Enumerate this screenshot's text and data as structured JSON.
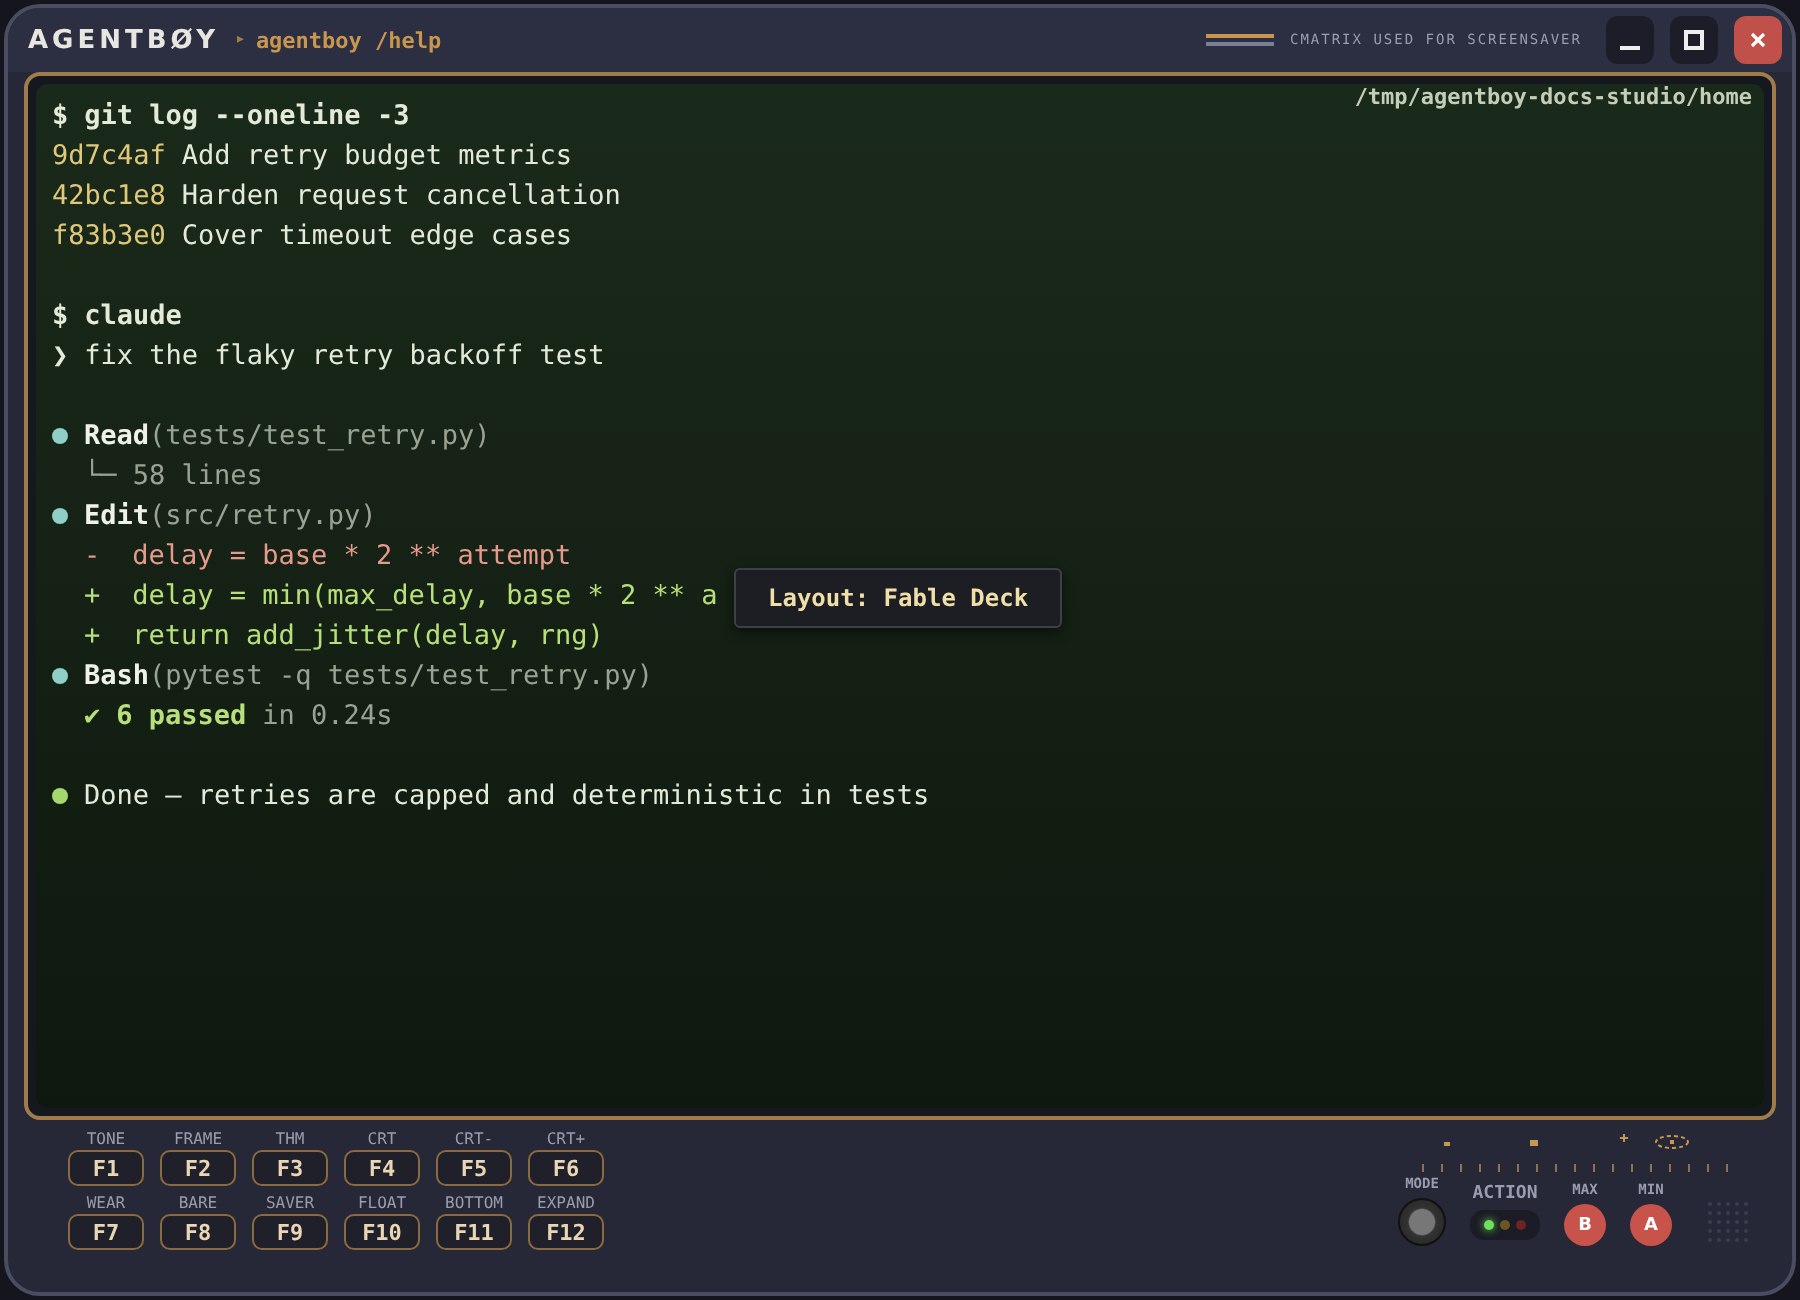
{
  "titlebar": {
    "logo": "AGENTBØY",
    "separator": "▸",
    "command": "agentboy /help",
    "notice": "CMATRIX USED FOR SCREENSAVER"
  },
  "terminal": {
    "path": "/tmp/agentboy-docs-studio/home",
    "lines": [
      {
        "kind": "command",
        "prompt": "$",
        "text": "git log --oneline -3"
      },
      {
        "kind": "commit",
        "hash": "9d7c4af",
        "text": "Add retry budget metrics"
      },
      {
        "kind": "commit",
        "hash": "42bc1e8",
        "text": "Harden request cancellation"
      },
      {
        "kind": "commit",
        "hash": "f83b3e0",
        "text": "Cover timeout edge cases"
      },
      {
        "kind": "blank"
      },
      {
        "kind": "command",
        "prompt": "$",
        "text": "claude"
      },
      {
        "kind": "input",
        "prompt": "❯",
        "text": "fix the flaky retry backoff test"
      },
      {
        "kind": "blank"
      },
      {
        "kind": "tool",
        "color": "#8ecfc6",
        "name": "Read",
        "args": "(tests/test_retry.py)"
      },
      {
        "kind": "output",
        "text": "└─ 58 lines"
      },
      {
        "kind": "tool",
        "color": "#8ecfc6",
        "name": "Edit",
        "args": "(src/retry.py)"
      },
      {
        "kind": "removed",
        "sign": "-",
        "text": "delay = base * 2 ** attempt"
      },
      {
        "kind": "added",
        "sign": "+",
        "text": "delay = min(max_delay, base * 2 ** a"
      },
      {
        "kind": "added",
        "sign": "+",
        "text": "return add_jitter(delay, rng)"
      },
      {
        "kind": "tool",
        "color": "#8ecfc6",
        "name": "Bash",
        "args": "(pytest -q tests/test_retry.py)"
      },
      {
        "kind": "pass",
        "mark": "✔",
        "text": "6 passed",
        "rest": "in 0.24s"
      },
      {
        "kind": "blank"
      },
      {
        "kind": "done",
        "color": "#a6d66e",
        "text": "Done — retries are capped and deterministic in tests"
      }
    ],
    "tooltip": "Layout: Fable Deck"
  },
  "function_keys": [
    [
      {
        "label": "TONE",
        "key": "F1"
      },
      {
        "label": "FRAME",
        "key": "F2"
      },
      {
        "label": "THM",
        "key": "F3"
      },
      {
        "label": "CRT",
        "key": "F4"
      },
      {
        "label": "CRT-",
        "key": "F5"
      },
      {
        "label": "CRT+",
        "key": "F6"
      }
    ],
    [
      {
        "label": "WEAR",
        "key": "F7"
      },
      {
        "label": "BARE",
        "key": "F8"
      },
      {
        "label": "SAVER",
        "key": "F9"
      },
      {
        "label": "FLOAT",
        "key": "F10"
      },
      {
        "label": "BOTTOM",
        "key": "F11"
      },
      {
        "label": "EXPAND",
        "key": "F12"
      }
    ]
  ],
  "controls": {
    "mode_label": "MODE",
    "action_label": "ACTION",
    "leds": [
      {
        "color": "#6ee05a",
        "on": true
      },
      {
        "color": "#6e5420",
        "on": false
      },
      {
        "color": "#6e2424",
        "on": false
      }
    ],
    "buttons": [
      {
        "label": "MAX",
        "key": "B"
      },
      {
        "label": "MIN",
        "key": "A"
      }
    ]
  }
}
